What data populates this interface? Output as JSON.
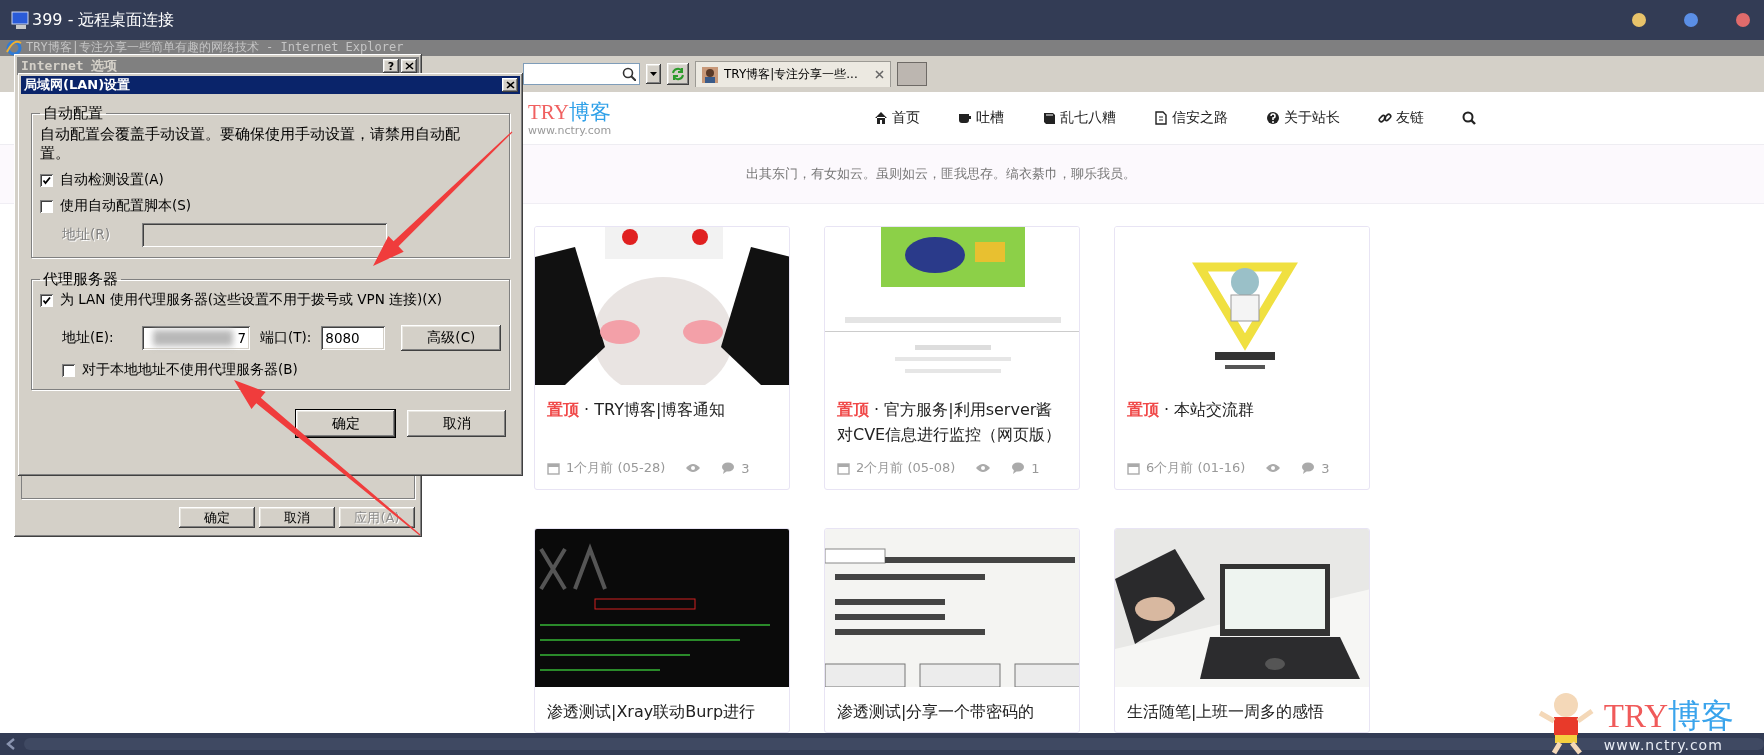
{
  "remote_desktop": {
    "title": "399 - 远程桌面连接"
  },
  "browser": {
    "title": "TRY博客|专注分享一些简单有趣的网络技术 - Internet Explorer",
    "tabs": [
      {
        "title": "TRY博客|专注分享一些...",
        "selected": true
      }
    ]
  },
  "site": {
    "logo": {
      "part_1": "TRY",
      "part_2": "博客",
      "domain": "www.nctry.com"
    },
    "nav": [
      {
        "label": "首页"
      },
      {
        "label": "吐槽"
      },
      {
        "label": "乱七八糟"
      },
      {
        "label": "信安之路"
      },
      {
        "label": "关于站长"
      },
      {
        "label": "友链"
      }
    ],
    "tagline": "出其东门，有女如云。虽则如云，匪我思存。缟衣綦巾，聊乐我员。",
    "posts": [
      {
        "title": "**置顶** · TRY博客|博客通知",
        "time": "1个月前 (05-28)",
        "comments": "3"
      },
      {
        "title": "**置顶** · 官方服务|利用server酱对CVE信息进行监控（网页版）",
        "time": "2个月前 (05-08)",
        "comments": "1"
      },
      {
        "title": "**置顶** · 本站交流群",
        "time": "6个月前 (01-16)",
        "comments": "3"
      },
      {
        "title": "渗透测试|Xray联动Burp进行"
      },
      {
        "title": "渗透测试|分享一个带密码的"
      },
      {
        "title": "生活随笔|上班一周多的感悟"
      }
    ],
    "corner_logo": {
      "part_1": "TRY",
      "part_2": "博客",
      "domain": "www.nctry.com"
    }
  },
  "internet_options": {
    "title": "Internet 选项",
    "help": "?",
    "buttons": [
      {
        "label": "确定",
        "disabled": false
      },
      {
        "label": "取消",
        "disabled": false
      },
      {
        "label": "应用(A)",
        "disabled": true
      }
    ]
  },
  "lan_dialog": {
    "title": "局域网(LAN)设置",
    "auto_config": {
      "legend": "自动配置",
      "description": "自动配置会覆盖手动设置。要确保使用手动设置，请禁用自动配置。",
      "options": [
        {
          "label": "自动检测设置(A)",
          "checked": true
        },
        {
          "label": "使用自动配置脚本(S)",
          "checked": false
        }
      ],
      "address": {
        "label": "地址(R)",
        "disabled": true
      }
    },
    "proxy": {
      "legend": "代理服务器",
      "use_proxy": {
        "label": "为 LAN 使用代理服务器(这些设置不用于拨号或 VPN 连接)(X)",
        "checked": true
      },
      "address": {
        "label": "地址(E):",
        "value": "7"
      },
      "port": {
        "label": "端口(T):",
        "value": "8080"
      },
      "advanced_button": "高级(C)",
      "bypass_local": {
        "label": "对于本地地址不使用代理服务器(B)",
        "checked": false
      }
    },
    "buttons": [
      {
        "label": "确定",
        "default": true
      },
      {
        "label": "取消",
        "default": false
      }
    ]
  }
}
